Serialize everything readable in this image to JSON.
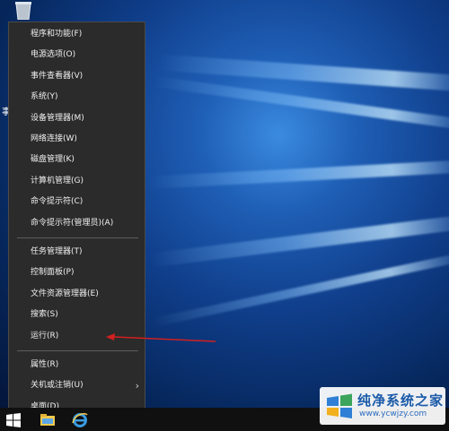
{
  "desktop": {
    "edge_text": "事"
  },
  "context_menu": {
    "groups": [
      [
        "程序和功能(F)",
        "电源选项(O)",
        "事件查看器(V)",
        "系统(Y)",
        "设备管理器(M)",
        "网络连接(W)",
        "磁盘管理(K)",
        "计算机管理(G)",
        "命令提示符(C)",
        "命令提示符(管理员)(A)"
      ],
      [
        "任务管理器(T)",
        "控制面板(P)",
        "文件资源管理器(E)",
        "搜索(S)",
        "运行(R)"
      ],
      [
        "属性(R)",
        "关机或注销(U)",
        "桌面(D)"
      ]
    ]
  },
  "watermark": {
    "title": "纯净系统之家",
    "url": "www.ycwjzy.com"
  },
  "colors": {
    "menu_bg": "#2b2b2b",
    "annotation_arrow": "#d21f1f",
    "desktop_blue": "#1f5fb6"
  },
  "icons": {
    "start": "windows-logo-icon",
    "explorer": "file-explorer-icon",
    "browser": "internet-explorer-icon",
    "submenu": "chevron-right-icon"
  }
}
